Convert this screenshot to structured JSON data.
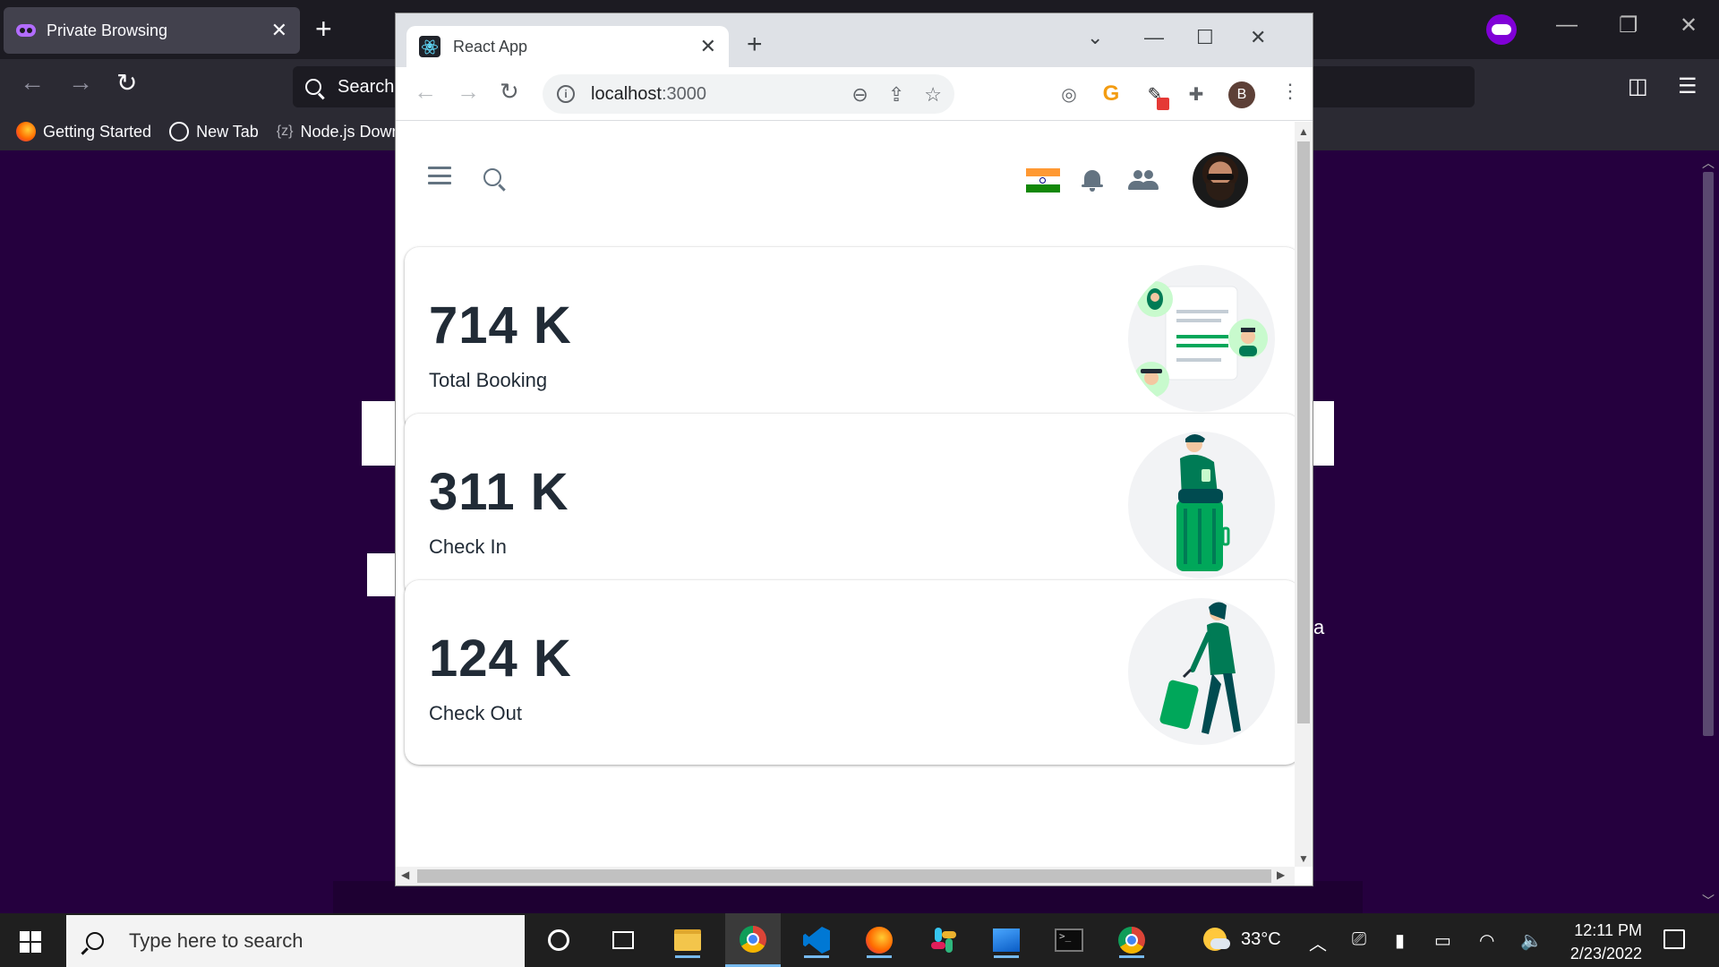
{
  "firefox": {
    "tab_title": "Private Browsing",
    "url_placeholder": "Search",
    "bookmarks": [
      {
        "label": "Getting Started"
      },
      {
        "label": "New Tab"
      },
      {
        "label": "Node.js Down"
      }
    ],
    "background_letter": "a"
  },
  "chrome": {
    "tab_title": "React App",
    "url_host": "localhost",
    "url_port": ":3000",
    "profile_initial": "B"
  },
  "app": {
    "cards": [
      {
        "value": "714 K",
        "label": "Total Booking",
        "illustration": "booking-illustration"
      },
      {
        "value": "311 K",
        "label": "Check In",
        "illustration": "check-in-illustration"
      },
      {
        "value": "124 K",
        "label": "Check Out",
        "illustration": "check-out-illustration"
      }
    ],
    "accent_color": "#00a75a",
    "flag": "india-flag"
  },
  "taskbar": {
    "search_placeholder": "Type here to search",
    "temperature": "33°C",
    "time": "12:11 PM",
    "date": "2/23/2022"
  }
}
